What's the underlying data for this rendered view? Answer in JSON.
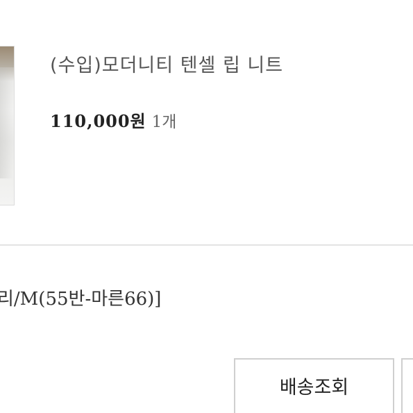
{
  "order_item": {
    "name": "(수입)모더니티 텐셀 립 니트",
    "price": "110,000원",
    "quantity": "1개"
  },
  "option": {
    "text": "리/M(55반-마른66)]"
  },
  "actions": {
    "track_delivery_label": "배송조회"
  }
}
